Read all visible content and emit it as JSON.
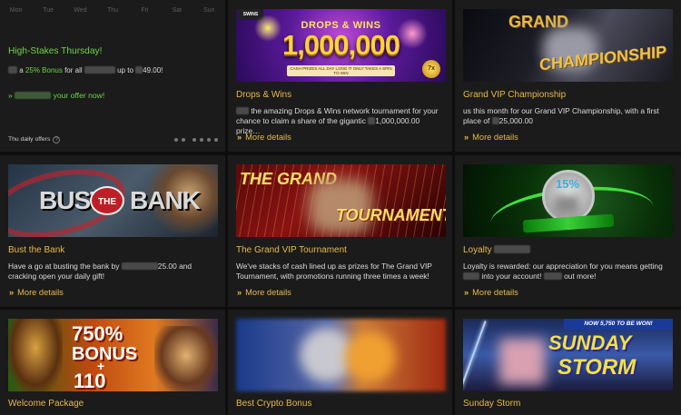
{
  "promo": {
    "days": [
      "Mon",
      "Tue",
      "Wed",
      "Thu",
      "Fri",
      "Sat",
      "Sun"
    ],
    "title": "High-Stakes Thursday!",
    "line_prefix": "a",
    "line_bonus": "25% Bonus",
    "line_mid": "for all",
    "line_upto": "up to",
    "line_amount": "49.00!",
    "cta_prefix": "»",
    "cta_text": "your offer now!",
    "daily_label": "Thu daily offers",
    "daily_help": "?"
  },
  "more_details_label": "More details",
  "more_details_chevron": "»",
  "cards": {
    "drops_wins": {
      "title": "Drops & Wins",
      "desc_a": "the amazing Drops & Wins network tournament for your chance to claim a share of the gigantic",
      "desc_b": "1,000,000.00 prize…",
      "banner": {
        "logo": "SWINS",
        "headline": "DROPS & WINS",
        "amount": "1,000,000",
        "strip": "CASH PRIZES ALL DAY LONG IT ONLY TAKES A SPIN TO WIN",
        "coin": "7x"
      }
    },
    "grand_vip_championship": {
      "title": "Grand VIP Championship",
      "desc_a": "us this month for our Grand VIP Championship, with a first place of",
      "desc_b": "25,000.00",
      "banner": {
        "line1": "GRAND",
        "line2": "CHAMPIONSHIP"
      }
    },
    "bust_the_bank": {
      "title": "Bust the Bank",
      "desc_a": "Have a go at busting the bank by",
      "desc_b": "25.00 and cracking open your daily gift!",
      "banner": {
        "word1": "BUST",
        "word2": "THE",
        "word3": "BANK"
      }
    },
    "grand_vip_tournament": {
      "title": "The Grand VIP Tournament",
      "desc": "We've stacks of cash lined up as prizes for The Grand VIP Tournament, with promotions running three times a week!",
      "banner": {
        "line1": "THE GRAND",
        "line2": "TOURNAMENT"
      }
    },
    "loyalty": {
      "title": "Loyalty",
      "desc_a": "Loyalty is rewarded: our appreciation for you means getting",
      "desc_b": "into your account!",
      "desc_c": "out more!",
      "banner": {
        "percent": "15%"
      }
    },
    "welcome": {
      "title": "Welcome Package",
      "banner": {
        "line1": "750%",
        "line2": "BONUS",
        "plus": "+",
        "line3": "110"
      }
    },
    "crypto": {
      "title": "Best Crypto Bonus"
    },
    "sunday_storm": {
      "title": "Sunday Storm",
      "banner": {
        "top": "NOW 5,750 TO BE WON!",
        "line1": "SUNDAY",
        "line2": "STORM"
      }
    }
  },
  "colors": {
    "accent_gold": "#e6b94a",
    "accent_green": "#6fd34a",
    "card_bg": "#1b1b1b",
    "page_bg": "#0d0d0d"
  }
}
